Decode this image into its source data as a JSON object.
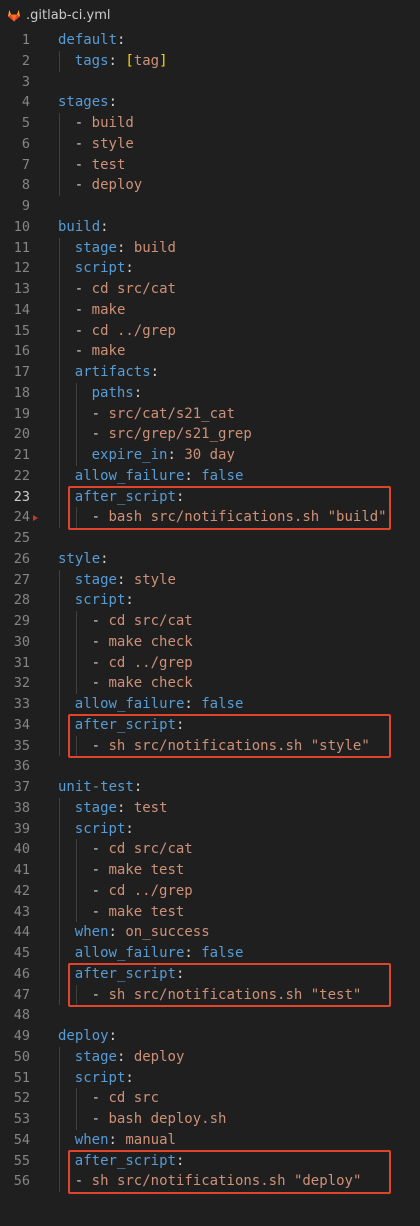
{
  "tab": {
    "filename": ".gitlab-ci.yml",
    "icon": "gitlab-icon"
  },
  "active_line": 23,
  "highlight_color": "#e0452b",
  "lines": [
    {
      "n": "1",
      "indent": 0,
      "tokens": [
        {
          "t": "key",
          "v": "default"
        },
        {
          "t": "punct",
          "v": ":"
        }
      ]
    },
    {
      "n": "2",
      "indent": 1,
      "tokens": [
        {
          "t": "key",
          "v": "tags"
        },
        {
          "t": "punct",
          "v": ": "
        },
        {
          "t": "bracket",
          "v": "["
        },
        {
          "t": "str",
          "v": "tag"
        },
        {
          "t": "bracket",
          "v": "]"
        }
      ]
    },
    {
      "n": "3",
      "indent": 0,
      "tokens": []
    },
    {
      "n": "4",
      "indent": 0,
      "tokens": [
        {
          "t": "key",
          "v": "stages"
        },
        {
          "t": "punct",
          "v": ":"
        }
      ]
    },
    {
      "n": "5",
      "indent": 1,
      "tokens": [
        {
          "t": "punct",
          "v": "- "
        },
        {
          "t": "str",
          "v": "build"
        }
      ]
    },
    {
      "n": "6",
      "indent": 1,
      "tokens": [
        {
          "t": "punct",
          "v": "- "
        },
        {
          "t": "str",
          "v": "style"
        }
      ]
    },
    {
      "n": "7",
      "indent": 1,
      "tokens": [
        {
          "t": "punct",
          "v": "- "
        },
        {
          "t": "str",
          "v": "test"
        }
      ]
    },
    {
      "n": "8",
      "indent": 1,
      "tokens": [
        {
          "t": "punct",
          "v": "- "
        },
        {
          "t": "str",
          "v": "deploy"
        }
      ]
    },
    {
      "n": "9",
      "indent": 0,
      "tokens": []
    },
    {
      "n": "10",
      "indent": 0,
      "tokens": [
        {
          "t": "key",
          "v": "build"
        },
        {
          "t": "punct",
          "v": ":"
        }
      ]
    },
    {
      "n": "11",
      "indent": 1,
      "tokens": [
        {
          "t": "key",
          "v": "stage"
        },
        {
          "t": "punct",
          "v": ": "
        },
        {
          "t": "str",
          "v": "build"
        }
      ]
    },
    {
      "n": "12",
      "indent": 1,
      "tokens": [
        {
          "t": "key",
          "v": "script"
        },
        {
          "t": "punct",
          "v": ":"
        }
      ]
    },
    {
      "n": "13",
      "indent": 1,
      "tokens": [
        {
          "t": "punct",
          "v": "- "
        },
        {
          "t": "str",
          "v": "cd src/cat"
        }
      ]
    },
    {
      "n": "14",
      "indent": 1,
      "tokens": [
        {
          "t": "punct",
          "v": "- "
        },
        {
          "t": "str",
          "v": "make"
        }
      ]
    },
    {
      "n": "15",
      "indent": 1,
      "tokens": [
        {
          "t": "punct",
          "v": "- "
        },
        {
          "t": "str",
          "v": "cd ../grep"
        }
      ]
    },
    {
      "n": "16",
      "indent": 1,
      "tokens": [
        {
          "t": "punct",
          "v": "- "
        },
        {
          "t": "str",
          "v": "make"
        }
      ]
    },
    {
      "n": "17",
      "indent": 1,
      "tokens": [
        {
          "t": "key",
          "v": "artifacts"
        },
        {
          "t": "punct",
          "v": ":"
        }
      ]
    },
    {
      "n": "18",
      "indent": 2,
      "tokens": [
        {
          "t": "key",
          "v": "paths"
        },
        {
          "t": "punct",
          "v": ":"
        }
      ]
    },
    {
      "n": "19",
      "indent": 2,
      "tokens": [
        {
          "t": "punct",
          "v": "- "
        },
        {
          "t": "str",
          "v": "src/cat/s21_cat"
        }
      ]
    },
    {
      "n": "20",
      "indent": 2,
      "tokens": [
        {
          "t": "punct",
          "v": "- "
        },
        {
          "t": "str",
          "v": "src/grep/s21_grep"
        }
      ]
    },
    {
      "n": "21",
      "indent": 2,
      "tokens": [
        {
          "t": "key",
          "v": "expire_in"
        },
        {
          "t": "punct",
          "v": ": "
        },
        {
          "t": "str",
          "v": "30 day"
        }
      ]
    },
    {
      "n": "22",
      "indent": 1,
      "tokens": [
        {
          "t": "key",
          "v": "allow_failure"
        },
        {
          "t": "punct",
          "v": ": "
        },
        {
          "t": "bool",
          "v": "false"
        }
      ]
    },
    {
      "n": "23",
      "indent": 1,
      "tokens": [
        {
          "t": "key",
          "v": "after_script"
        },
        {
          "t": "punct",
          "v": ":"
        }
      ]
    },
    {
      "n": "24",
      "indent": 2,
      "tokens": [
        {
          "t": "punct",
          "v": "- "
        },
        {
          "t": "str",
          "v": "bash src/notifications.sh \"build\""
        }
      ]
    },
    {
      "n": "25",
      "indent": 0,
      "tokens": []
    },
    {
      "n": "26",
      "indent": 0,
      "tokens": [
        {
          "t": "key",
          "v": "style"
        },
        {
          "t": "punct",
          "v": ":"
        }
      ]
    },
    {
      "n": "27",
      "indent": 1,
      "tokens": [
        {
          "t": "key",
          "v": "stage"
        },
        {
          "t": "punct",
          "v": ": "
        },
        {
          "t": "str",
          "v": "style"
        }
      ]
    },
    {
      "n": "28",
      "indent": 1,
      "tokens": [
        {
          "t": "key",
          "v": "script"
        },
        {
          "t": "punct",
          "v": ":"
        }
      ]
    },
    {
      "n": "29",
      "indent": 2,
      "tokens": [
        {
          "t": "punct",
          "v": "- "
        },
        {
          "t": "str",
          "v": "cd src/cat"
        }
      ]
    },
    {
      "n": "30",
      "indent": 2,
      "tokens": [
        {
          "t": "punct",
          "v": "- "
        },
        {
          "t": "str",
          "v": "make check"
        }
      ]
    },
    {
      "n": "31",
      "indent": 2,
      "tokens": [
        {
          "t": "punct",
          "v": "- "
        },
        {
          "t": "str",
          "v": "cd ../grep"
        }
      ]
    },
    {
      "n": "32",
      "indent": 2,
      "tokens": [
        {
          "t": "punct",
          "v": "- "
        },
        {
          "t": "str",
          "v": "make check"
        }
      ]
    },
    {
      "n": "33",
      "indent": 1,
      "tokens": [
        {
          "t": "key",
          "v": "allow_failure"
        },
        {
          "t": "punct",
          "v": ": "
        },
        {
          "t": "bool",
          "v": "false"
        }
      ]
    },
    {
      "n": "34",
      "indent": 1,
      "tokens": [
        {
          "t": "key",
          "v": "after_script"
        },
        {
          "t": "punct",
          "v": ":"
        }
      ]
    },
    {
      "n": "35",
      "indent": 2,
      "tokens": [
        {
          "t": "punct",
          "v": "- "
        },
        {
          "t": "str",
          "v": "sh src/notifications.sh \"style\""
        }
      ]
    },
    {
      "n": "36",
      "indent": 0,
      "tokens": []
    },
    {
      "n": "37",
      "indent": 0,
      "tokens": [
        {
          "t": "key",
          "v": "unit-test"
        },
        {
          "t": "punct",
          "v": ":"
        }
      ]
    },
    {
      "n": "38",
      "indent": 1,
      "tokens": [
        {
          "t": "key",
          "v": "stage"
        },
        {
          "t": "punct",
          "v": ": "
        },
        {
          "t": "str",
          "v": "test"
        }
      ]
    },
    {
      "n": "39",
      "indent": 1,
      "tokens": [
        {
          "t": "key",
          "v": "script"
        },
        {
          "t": "punct",
          "v": ":"
        }
      ]
    },
    {
      "n": "40",
      "indent": 2,
      "tokens": [
        {
          "t": "punct",
          "v": "- "
        },
        {
          "t": "str",
          "v": "cd src/cat"
        }
      ]
    },
    {
      "n": "41",
      "indent": 2,
      "tokens": [
        {
          "t": "punct",
          "v": "- "
        },
        {
          "t": "str",
          "v": "make test"
        }
      ]
    },
    {
      "n": "42",
      "indent": 2,
      "tokens": [
        {
          "t": "punct",
          "v": "- "
        },
        {
          "t": "str",
          "v": "cd ../grep"
        }
      ]
    },
    {
      "n": "43",
      "indent": 2,
      "tokens": [
        {
          "t": "punct",
          "v": "- "
        },
        {
          "t": "str",
          "v": "make test"
        }
      ]
    },
    {
      "n": "44",
      "indent": 1,
      "tokens": [
        {
          "t": "key",
          "v": "when"
        },
        {
          "t": "punct",
          "v": ": "
        },
        {
          "t": "str",
          "v": "on_success"
        }
      ]
    },
    {
      "n": "45",
      "indent": 1,
      "tokens": [
        {
          "t": "key",
          "v": "allow_failure"
        },
        {
          "t": "punct",
          "v": ": "
        },
        {
          "t": "bool",
          "v": "false"
        }
      ]
    },
    {
      "n": "46",
      "indent": 1,
      "tokens": [
        {
          "t": "key",
          "v": "after_script"
        },
        {
          "t": "punct",
          "v": ":"
        }
      ]
    },
    {
      "n": "47",
      "indent": 2,
      "tokens": [
        {
          "t": "punct",
          "v": "- "
        },
        {
          "t": "str",
          "v": "sh src/notifications.sh \"test\""
        }
      ]
    },
    {
      "n": "48",
      "indent": 0,
      "tokens": []
    },
    {
      "n": "49",
      "indent": 0,
      "tokens": [
        {
          "t": "key",
          "v": "deploy"
        },
        {
          "t": "punct",
          "v": ":"
        }
      ]
    },
    {
      "n": "50",
      "indent": 1,
      "tokens": [
        {
          "t": "key",
          "v": "stage"
        },
        {
          "t": "punct",
          "v": ": "
        },
        {
          "t": "str",
          "v": "deploy"
        }
      ]
    },
    {
      "n": "51",
      "indent": 1,
      "tokens": [
        {
          "t": "key",
          "v": "script"
        },
        {
          "t": "punct",
          "v": ":"
        }
      ]
    },
    {
      "n": "52",
      "indent": 2,
      "tokens": [
        {
          "t": "punct",
          "v": "- "
        },
        {
          "t": "str",
          "v": "cd src"
        }
      ]
    },
    {
      "n": "53",
      "indent": 2,
      "tokens": [
        {
          "t": "punct",
          "v": "- "
        },
        {
          "t": "str",
          "v": "bash deploy.sh"
        }
      ]
    },
    {
      "n": "54",
      "indent": 1,
      "tokens": [
        {
          "t": "key",
          "v": "when"
        },
        {
          "t": "punct",
          "v": ": "
        },
        {
          "t": "str",
          "v": "manual"
        }
      ]
    },
    {
      "n": "55",
      "indent": 1,
      "tokens": [
        {
          "t": "key",
          "v": "after_script"
        },
        {
          "t": "punct",
          "v": ":"
        }
      ]
    },
    {
      "n": "56",
      "indent": 1,
      "tokens": [
        {
          "t": "punct",
          "v": "- "
        },
        {
          "t": "str",
          "v": "sh src/notifications.sh \"deploy\""
        }
      ]
    }
  ],
  "highlights": [
    {
      "from": 23,
      "to": 24
    },
    {
      "from": 34,
      "to": 35
    },
    {
      "from": 46,
      "to": 47
    },
    {
      "from": 55,
      "to": 56
    }
  ]
}
